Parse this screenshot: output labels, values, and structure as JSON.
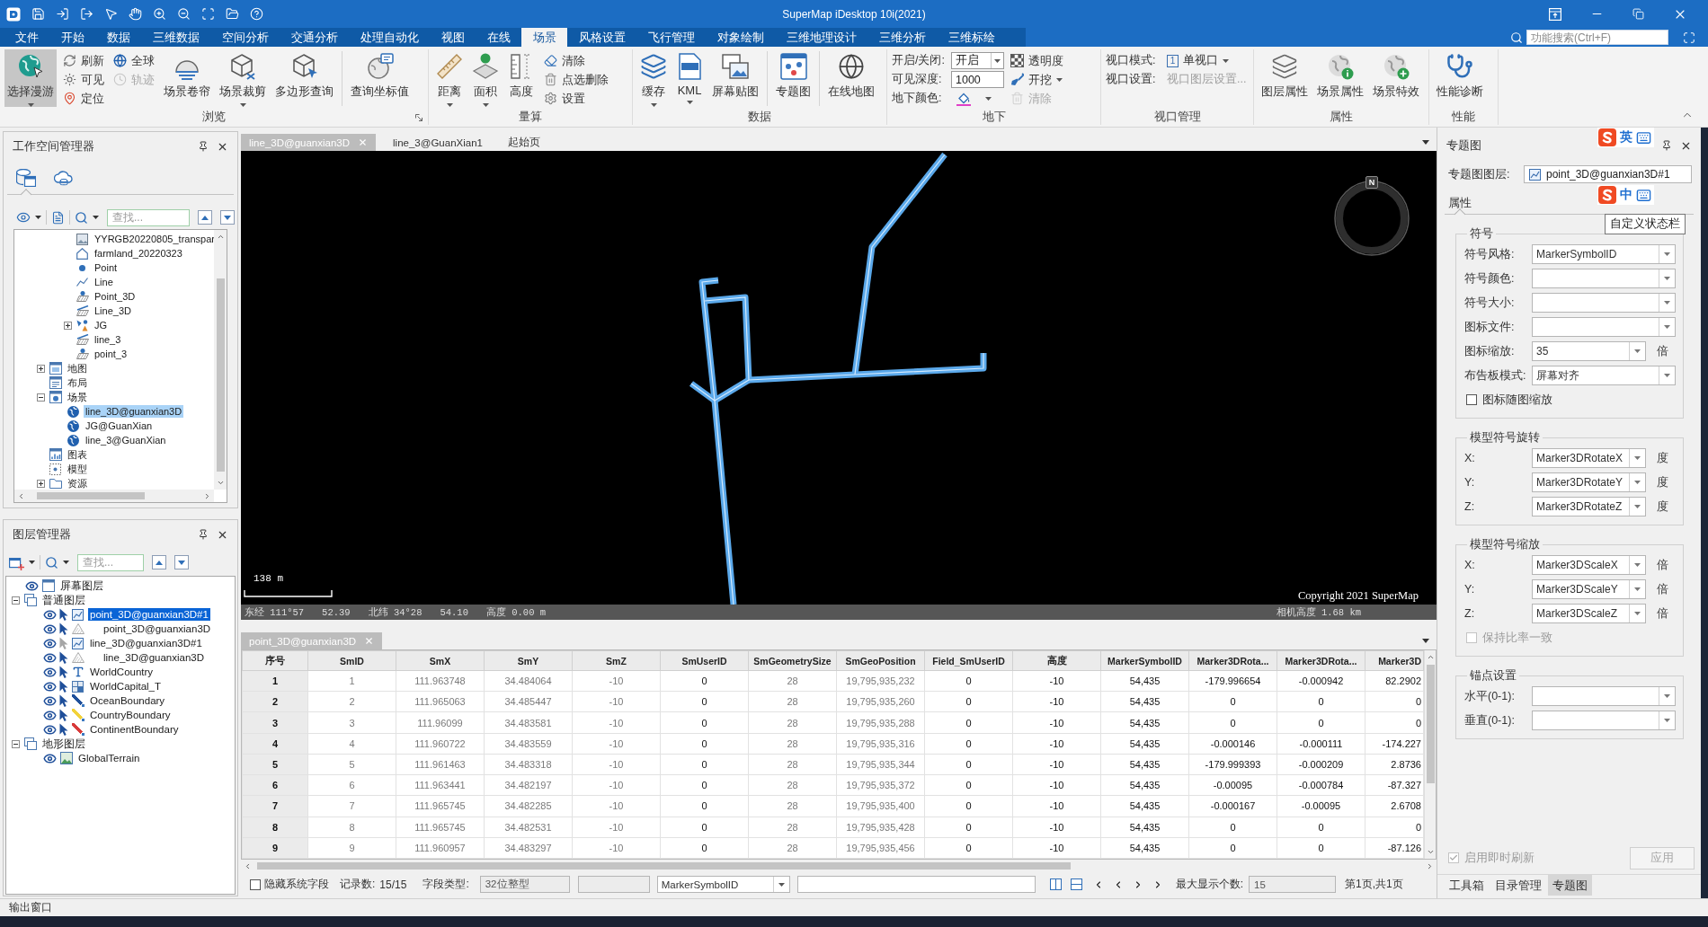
{
  "window": {
    "title": "SuperMap iDesktop 10i(2021)"
  },
  "menu_tabs": [
    {
      "label": "文件",
      "selected": false
    },
    {
      "label": "开始",
      "selected": false
    },
    {
      "label": "数据",
      "selected": false
    },
    {
      "label": "三维数据",
      "selected": false
    },
    {
      "label": "空间分析",
      "selected": false
    },
    {
      "label": "交通分析",
      "selected": false
    },
    {
      "label": "处理自动化",
      "selected": false
    },
    {
      "label": "视图",
      "selected": false
    },
    {
      "label": "在线",
      "selected": false
    },
    {
      "label": "场景",
      "selected": true
    },
    {
      "label": "风格设置",
      "selected": false
    },
    {
      "label": "飞行管理",
      "selected": false
    },
    {
      "label": "对象绘制",
      "selected": false
    },
    {
      "label": "三维地理设计",
      "selected": false
    },
    {
      "label": "三维分析",
      "selected": false
    },
    {
      "label": "三维标绘",
      "selected": false
    }
  ],
  "feature_search": {
    "placeholder": "功能搜索(Ctrl+F)"
  },
  "ribbon": {
    "groups": [
      {
        "label": "浏览",
        "launcher": true,
        "columns": [
          {
            "kind": "large",
            "label": "选择漫游",
            "pressed": true,
            "dropdown": true
          },
          {
            "kind": "stack",
            "items": [
              {
                "label": "刷新",
                "disabled": false,
                "dropdown": false
              },
              {
                "label": "可见",
                "disabled": false,
                "dropdown": false
              },
              {
                "label": "定位",
                "disabled": false,
                "dropdown": false
              }
            ]
          },
          {
            "kind": "stack",
            "items": [
              {
                "label": "全球",
                "disabled": false,
                "dropdown": false
              },
              {
                "label": "轨迹",
                "disabled": true,
                "dropdown": false
              }
            ]
          },
          {
            "kind": "large",
            "label": "场景卷帘",
            "pressed": false,
            "dropdown": false
          },
          {
            "kind": "large",
            "label": "场景裁剪",
            "pressed": false,
            "dropdown": true
          },
          {
            "kind": "large",
            "label": "多边形查询",
            "pressed": false,
            "dropdown": false
          },
          {
            "kind": "divider"
          },
          {
            "kind": "large",
            "label": "查询坐标值",
            "pressed": false,
            "dropdown": false
          }
        ]
      },
      {
        "label": "量算",
        "columns": [
          {
            "kind": "large",
            "label": "距离",
            "pressed": false,
            "dropdown": true
          },
          {
            "kind": "large",
            "label": "面积",
            "pressed": false,
            "dropdown": true
          },
          {
            "kind": "large",
            "label": "高度",
            "pressed": false,
            "dropdown": false
          },
          {
            "kind": "stack",
            "items": [
              {
                "label": "清除",
                "disabled": false,
                "dropdown": false
              },
              {
                "label": "点选删除",
                "disabled": false,
                "dropdown": false
              },
              {
                "label": "设置",
                "disabled": false,
                "dropdown": false
              }
            ]
          }
        ]
      },
      {
        "label": "数据",
        "columns": [
          {
            "kind": "large",
            "label": "缓存",
            "pressed": false,
            "dropdown": true
          },
          {
            "kind": "large",
            "label": "KML",
            "pressed": false,
            "dropdown": true
          },
          {
            "kind": "large",
            "label": "屏幕贴图",
            "pressed": false,
            "dropdown": false
          },
          {
            "kind": "divider"
          },
          {
            "kind": "large",
            "label": "专题图",
            "pressed": false,
            "dropdown": false
          },
          {
            "kind": "divider"
          },
          {
            "kind": "large",
            "label": "在线地图",
            "pressed": false,
            "dropdown": false
          }
        ]
      },
      {
        "label": "地下",
        "columns": [
          {
            "kind": "form",
            "rows": [
              {
                "kind": "combo",
                "label": "开启/关闭:",
                "value": "开启",
                "disabled": false
              },
              {
                "kind": "field",
                "label": "可见深度:",
                "value": "1000",
                "disabled": false
              },
              {
                "kind": "color",
                "label": "地下颜色:",
                "color": "#e040c8",
                "disabled": false
              }
            ]
          },
          {
            "kind": "stack",
            "items": [
              {
                "label": "透明度",
                "disabled": false,
                "dropdown": false
              },
              {
                "label": "开挖",
                "disabled": false,
                "dropdown": true
              },
              {
                "label": "清除",
                "disabled": true,
                "dropdown": false
              }
            ]
          }
        ]
      },
      {
        "label": "视口管理",
        "columns": [
          {
            "kind": "form",
            "rows": [
              {
                "kind": "menu",
                "label": "视口模式:",
                "badge": "1",
                "value": "单视口",
                "disabled": false
              },
              {
                "kind": "link",
                "label": "视口设置:",
                "value": "视口图层设置...",
                "disabled": true
              }
            ]
          }
        ]
      },
      {
        "label": "属性",
        "columns": [
          {
            "kind": "large",
            "label": "图层属性",
            "pressed": false,
            "dropdown": false
          },
          {
            "kind": "large",
            "label": "场景属性",
            "pressed": false,
            "dropdown": false
          },
          {
            "kind": "large",
            "label": "场景特效",
            "pressed": false,
            "dropdown": false
          }
        ]
      },
      {
        "label": "性能",
        "columns": [
          {
            "kind": "large",
            "label": "性能诊断",
            "pressed": false,
            "dropdown": false
          }
        ]
      }
    ]
  },
  "workspace_panel": {
    "title": "工作空间管理器",
    "view_tabs": [
      {
        "selected": true
      },
      {
        "selected": false
      }
    ],
    "search": {
      "placeholder": "查找..."
    },
    "tree": {
      "dataset_items": [
        {
          "label": "YYRGB20220805_transpar",
          "kind": "raster",
          "selected": false
        },
        {
          "label": "farmland_20220323",
          "kind": "region",
          "selected": false
        },
        {
          "label": "Point",
          "kind": "point",
          "selected": false
        },
        {
          "label": "Line",
          "kind": "line",
          "selected": false
        },
        {
          "label": "Point_3D",
          "kind": "point3d",
          "selected": false
        },
        {
          "label": "Line_3D",
          "kind": "line3d",
          "selected": false
        },
        {
          "label": "JG",
          "kind": "cad",
          "expanded": false,
          "selected": false
        },
        {
          "label": "line_3",
          "kind": "line3d",
          "selected": false
        },
        {
          "label": "point_3",
          "kind": "point3d",
          "selected": false
        }
      ],
      "nodes": [
        {
          "label": "地图",
          "kind": "map",
          "expanded": false,
          "selected": false
        },
        {
          "label": "布局",
          "kind": "layout",
          "selected": false
        },
        {
          "label": "场景",
          "kind": "scene",
          "expanded": true,
          "selected": false,
          "children": [
            {
              "label": "line_3D@guanxian3D",
              "kind": "scene_item",
              "selected": true
            },
            {
              "label": "JG@GuanXian",
              "kind": "scene_item",
              "selected": false
            },
            {
              "label": "line_3@GuanXian",
              "kind": "scene_item",
              "selected": false
            }
          ]
        },
        {
          "label": "图表",
          "kind": "chart",
          "selected": false
        },
        {
          "label": "模型",
          "kind": "model",
          "selected": false
        },
        {
          "label": "资源",
          "kind": "resources",
          "expanded": false,
          "selected": false
        }
      ]
    }
  },
  "layer_panel": {
    "title": "图层管理器",
    "search": {
      "placeholder": "查找..."
    },
    "layers": [
      {
        "label": "屏幕图层",
        "kind": "screen",
        "visible": true,
        "selected": false
      },
      {
        "label": "普通图层",
        "kind": "group",
        "expanded": true,
        "selected": false,
        "children": [
          {
            "label": "point_3D@guanxian3D#1",
            "kind": "thematic",
            "visible": true,
            "selectable": true,
            "selected": true,
            "children": [
              {
                "label": "point_3D@guanxian3D",
                "kind": "dataset",
                "visible": true,
                "selectable": true,
                "selected": false
              }
            ]
          },
          {
            "label": "line_3D@guanxian3D#1",
            "kind": "thematic",
            "visible": true,
            "selectable": false,
            "selected": false,
            "children": [
              {
                "label": "line_3D@guanxian3D",
                "kind": "dataset",
                "visible": true,
                "selectable": true,
                "selected": false
              }
            ]
          },
          {
            "label": "WorldCountry",
            "kind": "label",
            "visible": true,
            "selectable": true,
            "selected": false
          },
          {
            "label": "WorldCapital_T",
            "kind": "capital",
            "visible": true,
            "selectable": true,
            "selected": false
          },
          {
            "label": "OceanBoundary",
            "kind": "line",
            "color": "#1f4f9a",
            "visible": true,
            "selectable": true,
            "selected": false
          },
          {
            "label": "CountryBoundary",
            "kind": "line",
            "color": "#f2d23a",
            "visible": true,
            "selectable": true,
            "selected": false
          },
          {
            "label": "ContinentBoundary",
            "kind": "line",
            "color": "#d83a3a",
            "visible": true,
            "selectable": true,
            "selected": false
          }
        ]
      },
      {
        "label": "地形图层",
        "kind": "group",
        "expanded": true,
        "selected": false,
        "children": [
          {
            "label": "GlobalTerrain",
            "kind": "terrain",
            "visible": true,
            "selected": false
          }
        ]
      }
    ]
  },
  "document_tabs": [
    {
      "label": "line_3D@guanxian3D",
      "selected": true
    },
    {
      "label": "line_3@GuanXian1",
      "selected": false
    },
    {
      "label": "起始页",
      "selected": false
    }
  ],
  "scene": {
    "compass_label": "N",
    "scale_label": "138 m",
    "copyright": "Copyright 2021 SuperMap",
    "status": [
      "东经 111°57",
      "52.39",
      "北纬 34°28",
      "54.10",
      "高度 0.00 m"
    ],
    "camera_height": "相机高度 1.68 km"
  },
  "attribute_table": {
    "tab": {
      "label": "point_3D@guanxian3D",
      "selected": true
    },
    "columns": [
      {
        "label": "序号",
        "kind": "index"
      },
      {
        "label": "SmID",
        "kind": "system"
      },
      {
        "label": "SmX",
        "kind": "system"
      },
      {
        "label": "SmY",
        "kind": "system"
      },
      {
        "label": "SmZ",
        "kind": "system"
      },
      {
        "label": "SmUserID",
        "kind": "user"
      },
      {
        "label": "SmGeometrySize",
        "kind": "system"
      },
      {
        "label": "SmGeoPosition",
        "kind": "system"
      },
      {
        "label": "Field_SmUserID",
        "kind": "user"
      },
      {
        "label": "高度",
        "kind": "user"
      },
      {
        "label": "MarkerSymbolID",
        "kind": "user"
      },
      {
        "label": "Marker3DRota...",
        "kind": "user"
      },
      {
        "label": "Marker3DRota...",
        "kind": "user"
      },
      {
        "label": "Marker3D",
        "kind": "user"
      }
    ],
    "rows": [
      [
        "1",
        "1",
        "111.963748",
        "34.484064",
        "-10",
        "0",
        "28",
        "19,795,935,232",
        "0",
        "-10",
        "54,435",
        "-179.996654",
        "-0.000942",
        "82.2902"
      ],
      [
        "2",
        "2",
        "111.965063",
        "34.485447",
        "-10",
        "0",
        "28",
        "19,795,935,260",
        "0",
        "-10",
        "54,435",
        "0",
        "0",
        "0"
      ],
      [
        "3",
        "3",
        "111.96099",
        "34.483581",
        "-10",
        "0",
        "28",
        "19,795,935,288",
        "0",
        "-10",
        "54,435",
        "0",
        "0",
        "0"
      ],
      [
        "4",
        "4",
        "111.960722",
        "34.483559",
        "-10",
        "0",
        "28",
        "19,795,935,316",
        "0",
        "-10",
        "54,435",
        "-0.000146",
        "-0.000111",
        "-174.227"
      ],
      [
        "5",
        "5",
        "111.961463",
        "34.483318",
        "-10",
        "0",
        "28",
        "19,795,935,344",
        "0",
        "-10",
        "54,435",
        "-179.999393",
        "-0.000209",
        "2.8736"
      ],
      [
        "6",
        "6",
        "111.963441",
        "34.482197",
        "-10",
        "0",
        "28",
        "19,795,935,372",
        "0",
        "-10",
        "54,435",
        "-0.00095",
        "-0.000784",
        "-87.327"
      ],
      [
        "7",
        "7",
        "111.965745",
        "34.482285",
        "-10",
        "0",
        "28",
        "19,795,935,400",
        "0",
        "-10",
        "54,435",
        "-0.000167",
        "-0.00095",
        "2.6708"
      ],
      [
        "8",
        "8",
        "111.965745",
        "34.482531",
        "-10",
        "0",
        "28",
        "19,795,935,428",
        "0",
        "-10",
        "54,435",
        "0",
        "0",
        "0"
      ],
      [
        "9",
        "9",
        "111.960957",
        "34.483297",
        "-10",
        "0",
        "28",
        "19,795,935,456",
        "0",
        "-10",
        "54,435",
        "0",
        "0",
        "-87.126"
      ]
    ]
  },
  "table_toolbar": {
    "hide_system_fields": {
      "label": "隐藏系统字段",
      "checked": false
    },
    "record_label": "记录数:",
    "record_count": "15/15",
    "field_type_label": "字段类型:",
    "field_type_value": "32位整型",
    "field_select": "MarkerSymbolID",
    "max_label": "最大显示个数:",
    "max_value": "15",
    "page_info": "第1页,共1页"
  },
  "theme_panel": {
    "title": "专题图",
    "layer_label": "专题图图层:",
    "layer_value": "point_3D@guanxian3D#1",
    "tabs": [
      {
        "label": "属性",
        "selected": true
      }
    ],
    "groups": [
      {
        "title": "符号",
        "rows": [
          {
            "kind": "combo",
            "label": "符号风格:",
            "value": "MarkerSymbolID"
          },
          {
            "kind": "combo",
            "label": "符号颜色:"
          },
          {
            "kind": "combo",
            "label": "符号大小:"
          },
          {
            "kind": "combo",
            "label": "图标文件:"
          },
          {
            "kind": "combo",
            "label": "图标缩放:",
            "value": "35",
            "unit": "倍"
          },
          {
            "kind": "combo",
            "label": "布告板模式:",
            "value": "屏幕对齐"
          },
          {
            "kind": "check",
            "label": "图标随图缩放",
            "checked": false,
            "disabled": false
          }
        ]
      },
      {
        "title": "模型符号旋转",
        "rows": [
          {
            "kind": "combo",
            "label": "X:",
            "value": "Marker3DRotateX",
            "unit": "度"
          },
          {
            "kind": "combo",
            "label": "Y:",
            "value": "Marker3DRotateY",
            "unit": "度"
          },
          {
            "kind": "combo",
            "label": "Z:",
            "value": "Marker3DRotateZ",
            "unit": "度"
          }
        ]
      },
      {
        "title": "模型符号缩放",
        "rows": [
          {
            "kind": "combo",
            "label": "X:",
            "value": "Marker3DScaleX",
            "unit": "倍"
          },
          {
            "kind": "combo",
            "label": "Y:",
            "value": "Marker3DScaleY",
            "unit": "倍"
          },
          {
            "kind": "combo",
            "label": "Z:",
            "value": "Marker3DScaleZ",
            "unit": "倍"
          },
          {
            "kind": "check",
            "label": "保持比率一致",
            "checked": false,
            "disabled": true
          }
        ]
      },
      {
        "title": "锚点设置",
        "rows": [
          {
            "kind": "combo",
            "label": "水平(0-1):"
          },
          {
            "kind": "combo",
            "label": "垂直(0-1):"
          }
        ]
      }
    ],
    "live_refresh": {
      "label": "启用即时刷新",
      "checked": true,
      "disabled": true
    },
    "apply_button": {
      "label": "应用",
      "disabled": true
    },
    "bottom_tabs": [
      {
        "label": "工具箱",
        "selected": false
      },
      {
        "label": "目录管理",
        "selected": false
      },
      {
        "label": "专题图",
        "selected": true
      }
    ]
  },
  "ime": {
    "indicators": [
      {
        "label": "英"
      },
      {
        "label": "中"
      }
    ],
    "tooltip": "自定义状态栏"
  },
  "output_window_tab": "输出窗口"
}
